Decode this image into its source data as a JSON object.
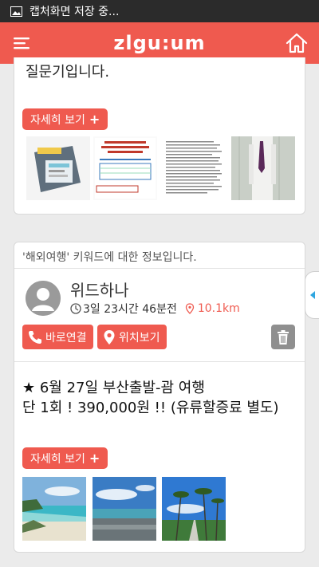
{
  "statusbar": {
    "text": "캡처화면 저장 중...",
    "icon": "image-icon"
  },
  "header": {
    "logo": "zlgu:um",
    "menu_icon": "menu-icon",
    "home_icon": "home-icon"
  },
  "card1": {
    "cut_text": "질문기입니다.",
    "more_label": "자세히 보기",
    "thumbnails": [
      "product-box-image",
      "document-image-1",
      "document-image-2",
      "person-photo"
    ]
  },
  "card2": {
    "heading": "'해외여행' 키워드에 대한 정보입니다.",
    "user_name": "위드하나",
    "time_ago": "3일 23시간 46분전",
    "distance": "10.1km",
    "call_label": "바로연결",
    "location_label": "위치보기",
    "post_line1": "★ 6월 27일 부산출발-괌 여행",
    "post_line2": "단 1회 !  390,000원 !! (유류할증료 별도)",
    "more_label": "자세히 보기",
    "thumbnails": [
      "beach-photo-1",
      "beach-photo-2",
      "palm-road-photo"
    ]
  },
  "colors": {
    "accent": "#ef5a4f",
    "background": "#ebebeb"
  }
}
